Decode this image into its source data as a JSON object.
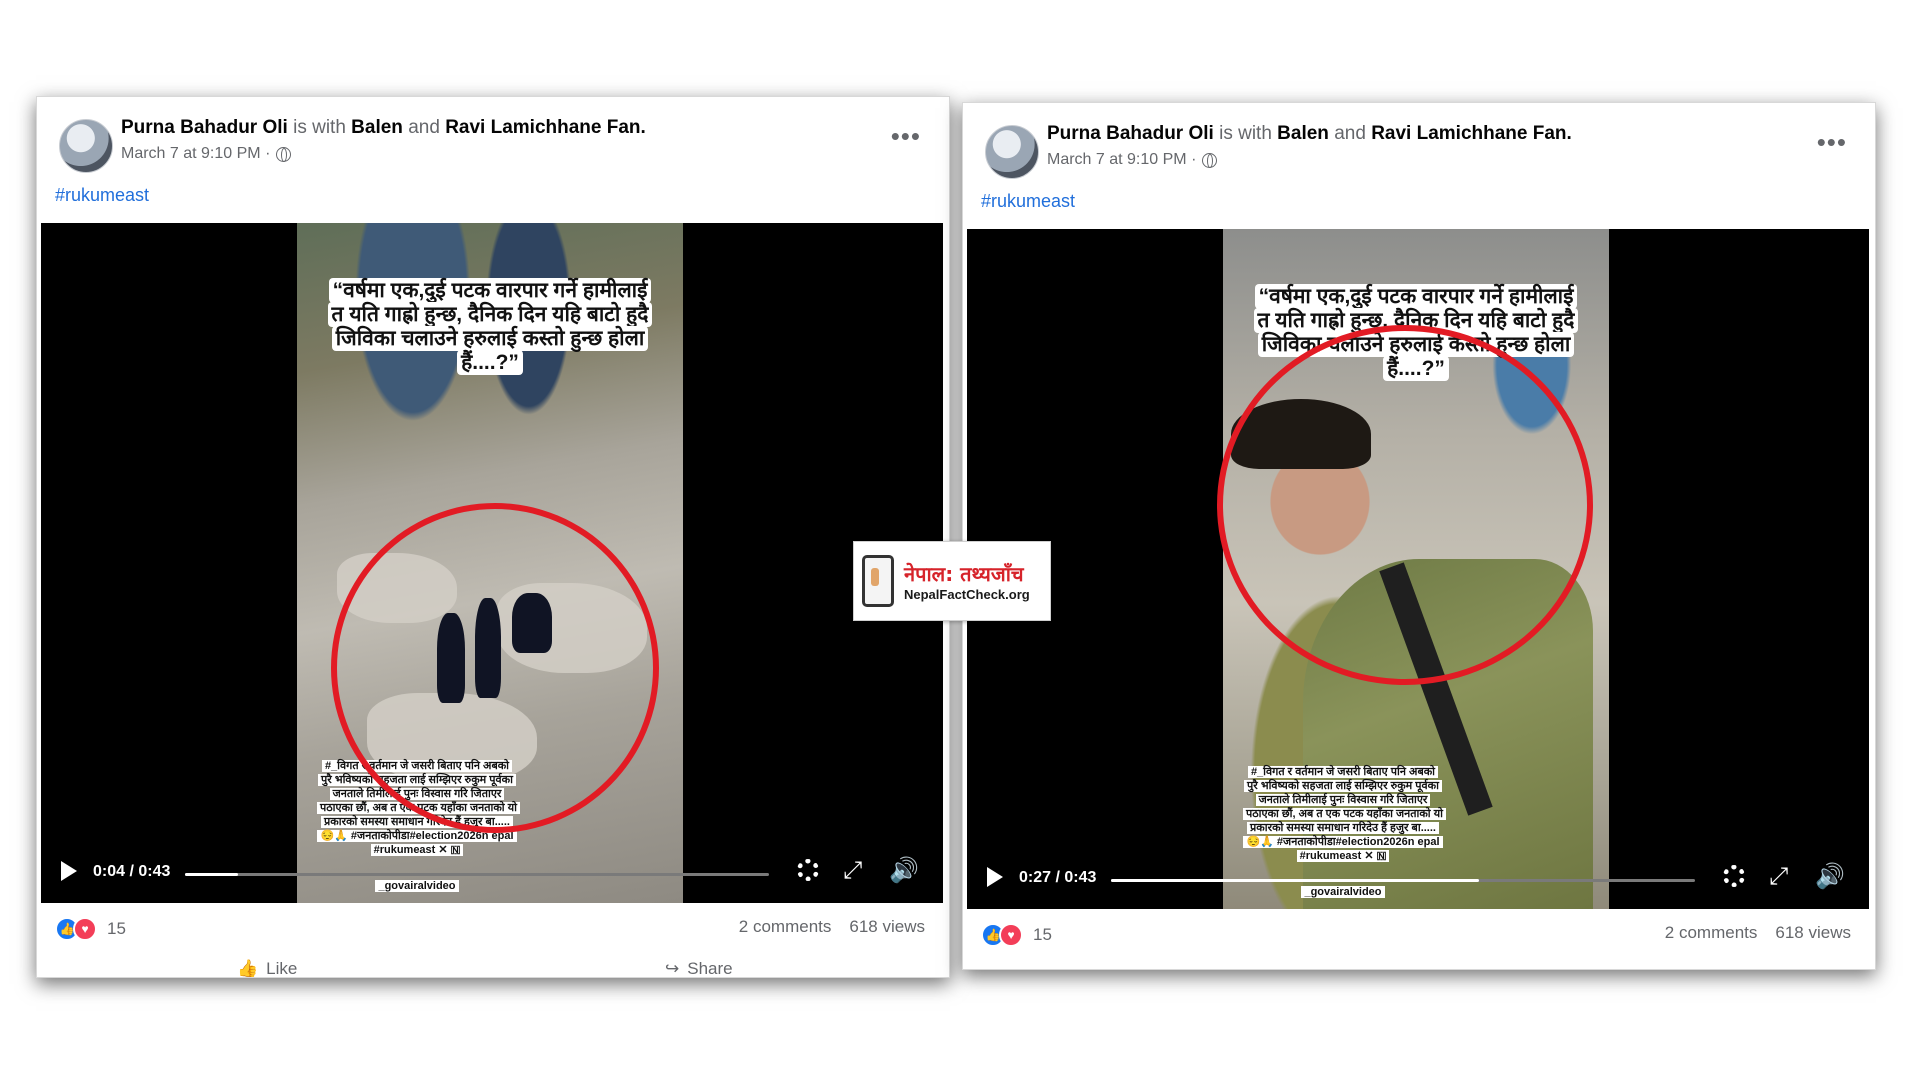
{
  "posts": [
    {
      "author": "Purna Bahadur Oli",
      "with_word": "is with",
      "tag1": "Balen",
      "and_word": "and",
      "tag2": "Ravi Lamichhane Fan.",
      "timestamp": "March 7 at 9:10 PM ·",
      "hashtag": "#rukumeast",
      "overlay_top": "“वर्षमा एक,दुई पटक वारपार गर्ने हामीलाई त यति गाह्रो हुन्छ, दैनिक दिन यहि बाटो हुदै जिविका चलाउने हरुलाई कस्तो हुन्छ होला हैं....?”",
      "overlay_bottom": "#_विगत र वर्तमान जे जसरी बिताए पनि अबको पुरै भविष्यको सहजता लाई सम्झिएर रुकुम पूर्वका जनताले तिमीलाई पुनः विस्वास गरि जिताएर पठाएका छौं, अब त एक पटक यहाँका जनताको यो प्रकारको समस्या समाधान गरिदेउ हैं हजुर बा.....😔🙏 #जनताकोपीडा#election2026n epal #rukumeast ✕ 🇳",
      "credit": "_govairalvideo",
      "time_display": "0:04 / 0:43",
      "progress": 0.09,
      "reaction_count": "15",
      "comments": "2 comments",
      "views": "618 views",
      "like_label": "Like",
      "share_label": "Share"
    },
    {
      "author": "Purna Bahadur Oli",
      "with_word": "is with",
      "tag1": "Balen",
      "and_word": "and",
      "tag2": "Ravi Lamichhane Fan.",
      "timestamp": "March 7 at 9:10 PM ·",
      "hashtag": "#rukumeast",
      "overlay_top": "“वर्षमा एक,दुई पटक वारपार गर्ने हामीलाई त यति गाह्रो हुन्छ, दैनिक दिन यहि बाटो हुदै जिविका चलाउने हरुलाई कस्तो हुन्छ होला हैं....?”",
      "overlay_bottom": "#_विगत र वर्तमान जे जसरी बिताए पनि अबको पुरै भविष्यको सहजता लाई सम्झिएर रुकुम पूर्वका जनताले तिमीलाई पुनः विस्वास गरि जिताएर पठाएका छौं, अब त एक पटक यहाँका जनताको यो प्रकारको समस्या समाधान गरिदेउ हैं हजुर बा.....😔🙏 #जनताकोपीडा#election2026n epal #rukumeast ✕ 🇳",
      "credit": "_govairalvideo",
      "time_display": "0:27 / 0:43",
      "progress": 0.63,
      "reaction_count": "15",
      "comments": "2 comments",
      "views": "618 views"
    }
  ],
  "logo": {
    "nepali": "नेपाल: तथ्यजाँच",
    "url": "NepalFactCheck.org"
  },
  "colors": {
    "accent_red": "#e21b24",
    "link_blue": "#216fdb",
    "like_blue": "#1877f2",
    "love_red": "#f33e58"
  },
  "icons": [
    "play-icon",
    "settings-gear-icon",
    "fullscreen-icon",
    "volume-icon",
    "more-options-icon",
    "globe-icon",
    "like-reaction-icon",
    "love-reaction-icon",
    "like-thumb-icon",
    "share-arrow-icon",
    "phone-hand-icon"
  ]
}
